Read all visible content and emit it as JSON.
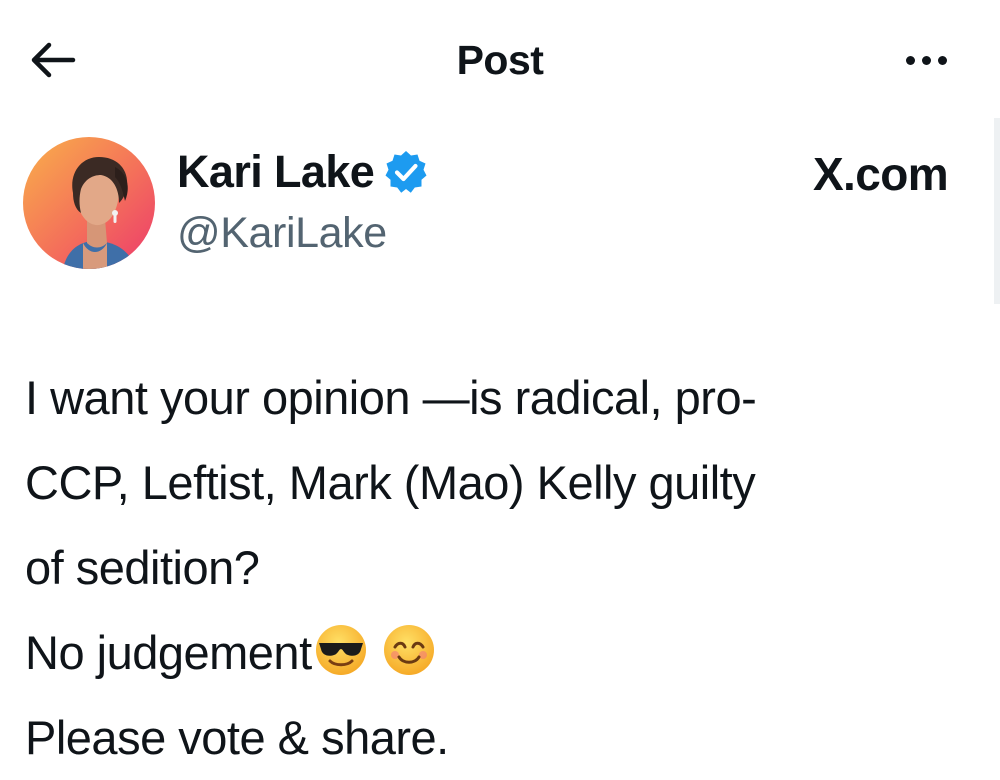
{
  "header": {
    "title": "Post",
    "back_icon": "arrow-left-icon",
    "more_icon": "more-horizontal-icon"
  },
  "author": {
    "name": "Kari Lake",
    "handle": "@KariLake",
    "verified": true,
    "verified_color": "#1d9bf0"
  },
  "source": {
    "brand": "X.com"
  },
  "tweet": {
    "lines": [
      "I want your opinion —is radical, pro-",
      "CCP, Leftist, Mark (Mao) Kelly guilty",
      "of sedition?",
      "No judgement",
      "Please vote & share."
    ],
    "emojis": [
      "smiling-face-with-sunglasses-icon",
      "smiling-face-with-smiling-eyes-icon"
    ]
  },
  "colors": {
    "text": "#0f1419",
    "secondary_text": "#536471",
    "avatar_bg_start": "#f7a24a",
    "avatar_bg_end": "#ef3b6e"
  }
}
